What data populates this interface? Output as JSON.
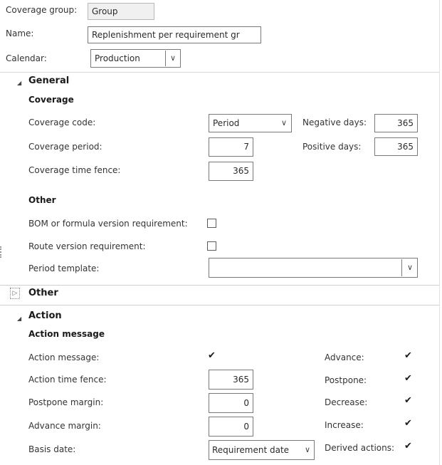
{
  "header": {
    "coverage_group_label": "Coverage group:",
    "coverage_group_value": "Group",
    "name_label": "Name:",
    "name_value": "Replenishment per requirement gr",
    "calendar_label": "Calendar:",
    "calendar_value": "Production"
  },
  "general": {
    "title": "General",
    "coverage_title": "Coverage",
    "coverage_code_label": "Coverage code:",
    "coverage_code_value": "Period",
    "coverage_period_label": "Coverage period:",
    "coverage_period_value": "7",
    "coverage_time_fence_label": "Coverage time fence:",
    "coverage_time_fence_value": "365",
    "negative_days_label": "Negative days:",
    "negative_days_value": "365",
    "positive_days_label": "Positive days:",
    "positive_days_value": "365",
    "other_title": "Other",
    "bom_label": "BOM or formula version requirement:",
    "bom_checked": false,
    "route_label": "Route version requirement:",
    "route_checked": false,
    "period_template_label": "Period template:",
    "period_template_value": ""
  },
  "other_section": {
    "title": "Other",
    "expanded": false
  },
  "action": {
    "title": "Action",
    "action_message_title": "Action message",
    "action_message_label": "Action message:",
    "action_message_checked": true,
    "action_time_fence_label": "Action time fence:",
    "action_time_fence_value": "365",
    "postpone_margin_label": "Postpone margin:",
    "postpone_margin_value": "0",
    "advance_margin_label": "Advance margin:",
    "advance_margin_value": "0",
    "basis_date_label": "Basis date:",
    "basis_date_value": "Requirement date",
    "advance_label": "Advance:",
    "advance_checked": true,
    "postpone_label": "Postpone:",
    "postpone_checked": true,
    "decrease_label": "Decrease:",
    "decrease_checked": true,
    "increase_label": "Increase:",
    "increase_checked": true,
    "derived_actions_label": "Derived actions:",
    "derived_actions_checked": true
  },
  "icons": {
    "collapse": "triangle-down-icon",
    "expand": "triangle-right-icon",
    "dropdown": "chevron-down-icon",
    "check": "checkmark-icon"
  },
  "check_glyph": "✔",
  "chevron_glyph": "∨",
  "collapse_glyph": "◢",
  "expand_glyph": "▷"
}
